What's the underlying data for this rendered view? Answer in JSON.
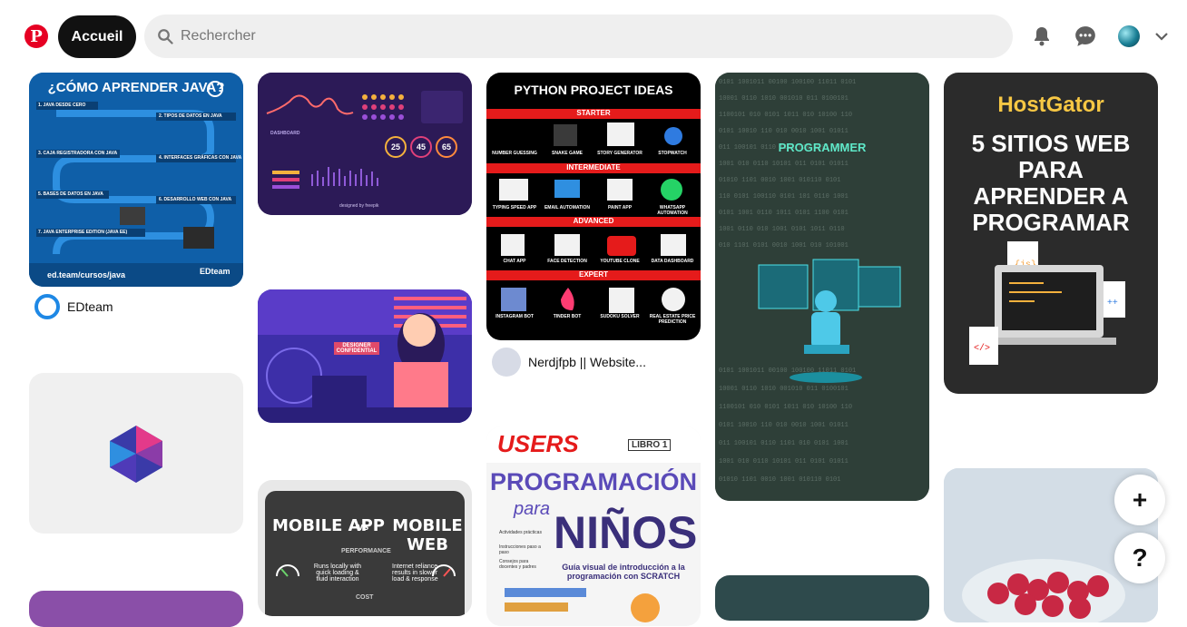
{
  "header": {
    "logo": "P",
    "home_label": "Accueil",
    "search_placeholder": "Rechercher",
    "icons": [
      "bell-icon",
      "chat-icon",
      "avatar",
      "chevron-down-icon"
    ]
  },
  "pins": {
    "java": {
      "title": "¿CÓMO APRENDER JAVA?",
      "steps": [
        "1. JAVA DESDE CERO",
        "2. TIPOS DE DATOS EN JAVA",
        "3. CAJA REGISTRADORA CON JAVA",
        "4. INTERFACES GRÁFICAS CON JAVA",
        "5. BASES DE DATOS EN JAVA",
        "6. DESARROLLO WEB CON JAVA",
        "7. JAVA ENTERPRISE EDITION (JAVA EE)"
      ],
      "footer": "ed.team/cursos/java",
      "brand": "EDteam",
      "creator": "EDteam"
    },
    "dashboard": {
      "label": "DASHBOARD",
      "stats": [
        "25",
        "45",
        "65"
      ],
      "credit": "designed by freepik"
    },
    "python": {
      "title": "PYTHON PROJECT IDEAS",
      "sections": [
        {
          "name": "STARTER",
          "items": [
            "NUMBER GUESSING",
            "SNAKE GAME",
            "STORY GENERATOR",
            "STOPWATCH"
          ]
        },
        {
          "name": "INTERMEDIATE",
          "items": [
            "TYPING SPEED APP",
            "EMAIL AUTOMATION",
            "PAINT APP",
            "WHATSAPP AUTOMATION"
          ]
        },
        {
          "name": "ADVANCED",
          "items": [
            "CHAT APP",
            "FACE DETECTION",
            "YOUTUBE CLONE",
            "DATA DASHBOARD"
          ]
        },
        {
          "name": "EXPERT",
          "items": [
            "INSTAGRAM BOT",
            "TINDER BOT",
            "SUDOKU SOLVER",
            "REAL ESTATE PRICE PREDICTION"
          ]
        }
      ],
      "creator": "Nerdjfpb || Website..."
    },
    "programmer": {
      "title": "PROGRAMMER"
    },
    "hostgator": {
      "brand": "HostGator",
      "title": "5 SITIOS WEB PARA APRENDER A PROGRAMAR"
    },
    "designer": {
      "sign": "DESIGNER CONFIDENTIAL"
    },
    "mobile": {
      "title_left": "MOBILE APP",
      "vs": "vs",
      "title_right": "MOBILE WEB",
      "section": "PERFORMANCE",
      "left_text": "Runs locally with quick loading & fluid interaction",
      "right_text": "Internet reliance results in slower load & response",
      "section2": "COST"
    },
    "users": {
      "brand": "USERS",
      "book": "LIBRO 1",
      "title1": "PROGRAMACIÓN",
      "title2": "para",
      "title3": "NIÑOS",
      "subtitle": "Guía visual de introducción a la programación con SCRATCH",
      "bullets": [
        "Actividades prácticas",
        "Instrucciones paso a paso",
        "Consejos para docentes y padres"
      ]
    }
  },
  "fab": {
    "add": "+",
    "help": "?"
  },
  "colors": {
    "brand": "#e60023",
    "search_bg": "#efefef"
  }
}
